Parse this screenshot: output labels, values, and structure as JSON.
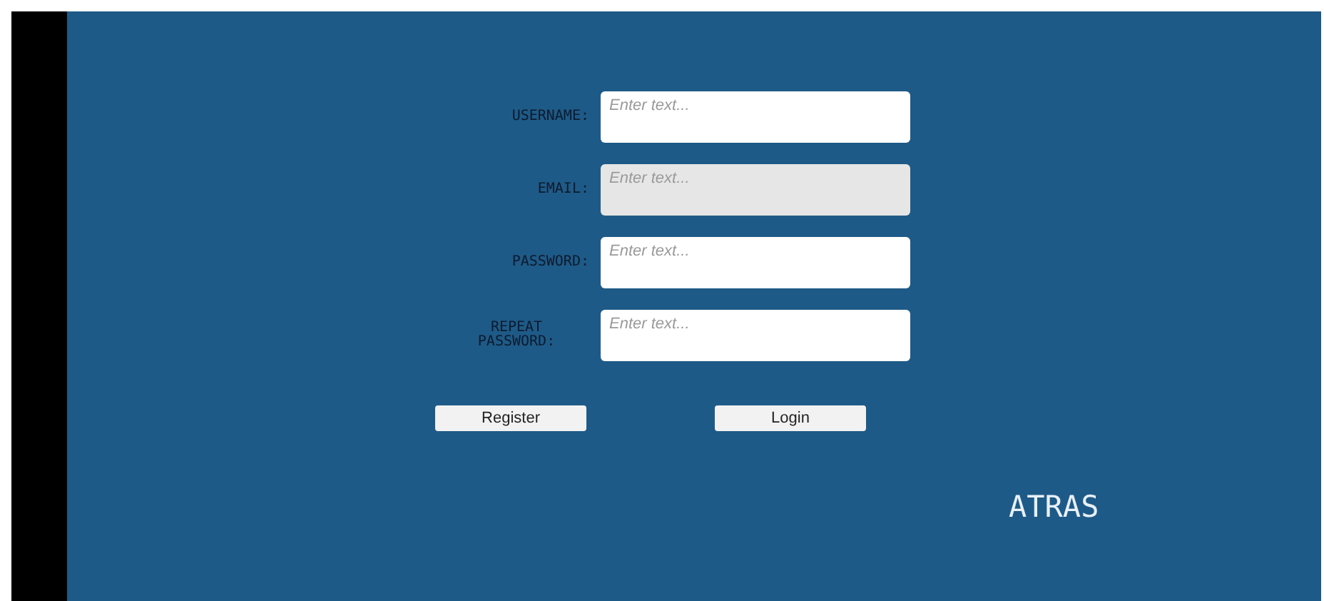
{
  "fields": [
    {
      "label": "USERNAME:",
      "placeholder": "Enter text...",
      "highlighted": false
    },
    {
      "label": "EMAIL:",
      "placeholder": "Enter text...",
      "highlighted": true
    },
    {
      "label": "PASSWORD:",
      "placeholder": "Enter text...",
      "highlighted": false
    },
    {
      "label": "REPEAT PASSWORD:",
      "placeholder": "Enter text...",
      "highlighted": false
    }
  ],
  "buttons": [
    "Register",
    "Login"
  ],
  "back_label": "ATRAS"
}
